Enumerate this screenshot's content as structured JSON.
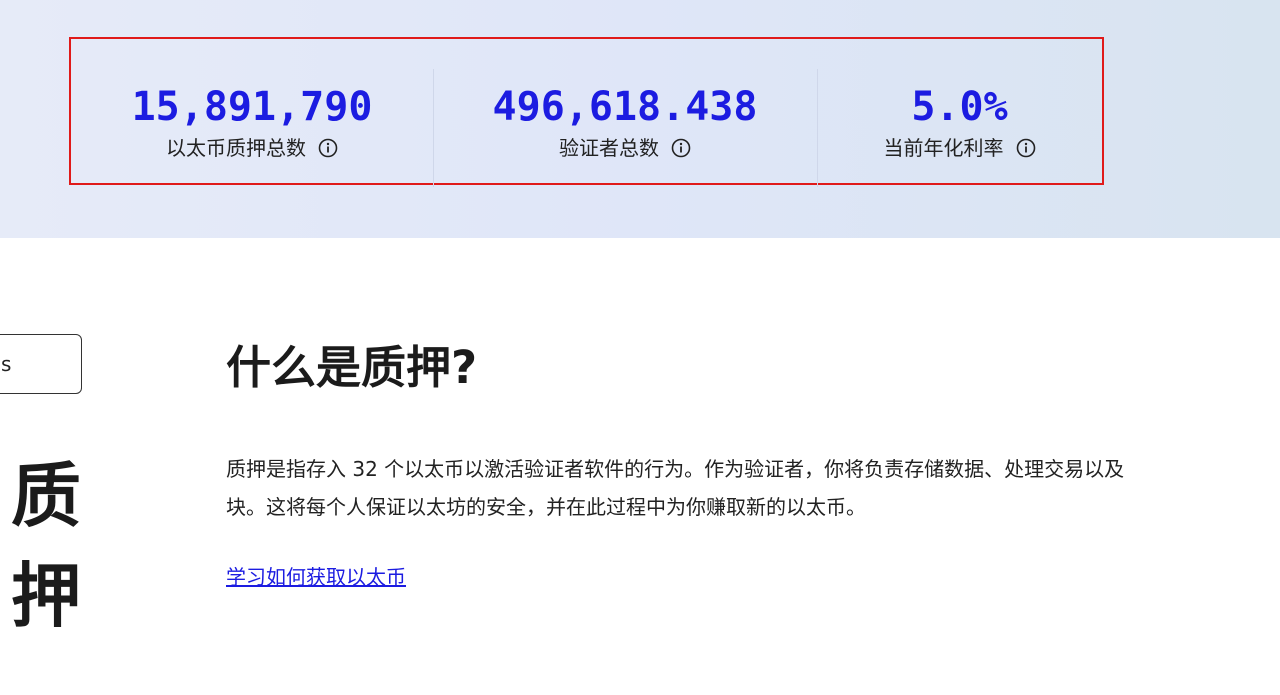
{
  "stats": [
    {
      "value": "15,891,790",
      "label": "以太币质押总数"
    },
    {
      "value": "496,618.438",
      "label": "验证者总数"
    },
    {
      "value": "5.0%",
      "label": "当前年化利率"
    }
  ],
  "side": {
    "button_label": "s",
    "title_line1": "质",
    "title_line2": "押"
  },
  "main": {
    "title": "什么是质押?",
    "body_line1": "质押是指存入 32 个以太币以激活验证者软件的行为。作为验证者，你将负责存储数据、处理交易以及",
    "body_line2": "块。这将每个人保证以太坊的安全，并在此过程中为你赚取新的以太币。",
    "link_label": "学习如何获取以太币"
  },
  "colors": {
    "accent": "#1c1ce1",
    "highlight_border": "#e01a1a"
  },
  "icons": {
    "stat_info": "info-icon"
  }
}
